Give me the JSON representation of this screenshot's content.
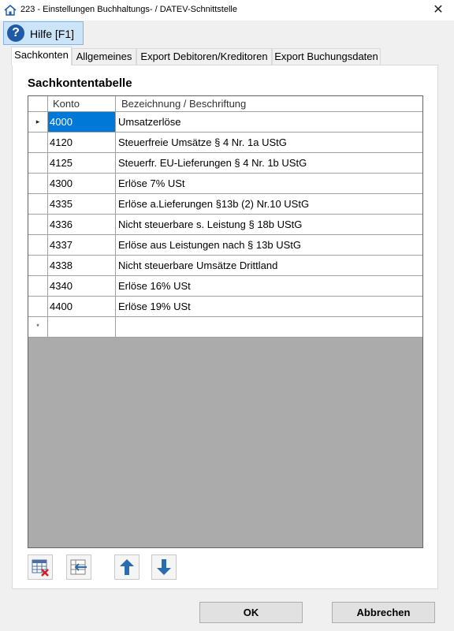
{
  "window": {
    "title": "223 - Einstellungen Buchhaltungs- / DATEV-Schnittstelle",
    "close_glyph": "✕"
  },
  "help": {
    "glyph": "?",
    "label": "Hilfe  [F1]"
  },
  "tabs": [
    {
      "label": "Sachkonten",
      "active": true
    },
    {
      "label": "Allgemeines",
      "active": false
    },
    {
      "label": "Export Debitoren/Kreditoren",
      "active": false
    },
    {
      "label": "Export Buchungsdaten",
      "active": false
    }
  ],
  "section_title": "Sachkontentabelle",
  "table": {
    "columns": [
      "Konto",
      "Bezeichnung / Beschriftung"
    ],
    "current_row_marker": "▸",
    "new_row_marker": "*",
    "rows": [
      {
        "konto": "4000",
        "bezeichnung": "Umsatzerlöse"
      },
      {
        "konto": "4120",
        "bezeichnung": "Steuerfreie Umsätze § 4 Nr. 1a UStG"
      },
      {
        "konto": "4125",
        "bezeichnung": "Steuerfr. EU-Lieferungen § 4 Nr. 1b UStG"
      },
      {
        "konto": "4300",
        "bezeichnung": "Erlöse 7% USt"
      },
      {
        "konto": "4335",
        "bezeichnung": "Erlöse a.Lieferungen §13b (2) Nr.10 UStG"
      },
      {
        "konto": "4336",
        "bezeichnung": "Nicht steuerbare s. Leistung § 18b UStG"
      },
      {
        "konto": "4337",
        "bezeichnung": "Erlöse aus Leistungen nach § 13b UStG"
      },
      {
        "konto": "4338",
        "bezeichnung": "Nicht steuerbare Umsätze Drittland"
      },
      {
        "konto": "4340",
        "bezeichnung": "Erlöse 16% USt"
      },
      {
        "konto": "4400",
        "bezeichnung": "Erlöse 19% USt"
      }
    ]
  },
  "toolbar_icons": [
    "delete-row-icon",
    "insert-row-icon",
    "move-up-icon",
    "move-down-icon"
  ],
  "buttons": {
    "ok": "OK",
    "cancel": "Abbrechen"
  },
  "colors": {
    "selection": "#0078d7",
    "help_icon": "#1e5aa8",
    "arrow": "#2b6cb0"
  }
}
